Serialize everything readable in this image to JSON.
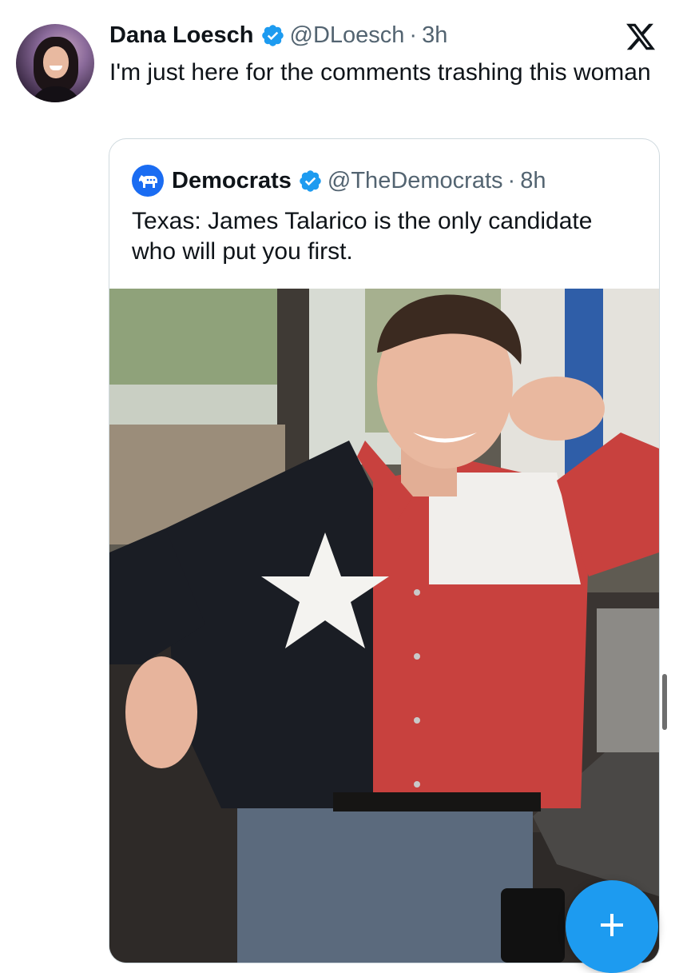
{
  "tweet": {
    "author": {
      "display_name": "Dana Loesch",
      "handle": "@DLoesch",
      "time": "3h",
      "verified": true
    },
    "text": "I'm just here for the comments trashing this woman",
    "quoted": {
      "author": {
        "display_name": "Democrats",
        "handle": "@TheDemocrats",
        "time": "8h",
        "verified": true
      },
      "text": "Texas: James Talarico is the only candidate who will put you first."
    }
  },
  "separator": "·",
  "icons": {
    "app_logo": "x-logo-icon",
    "verified": "verified-badge-icon",
    "compose": "plus-icon"
  },
  "colors": {
    "accent": "#1d9bf0",
    "secondary_text": "#536471",
    "democrats_blue": "#1a6cf2"
  }
}
